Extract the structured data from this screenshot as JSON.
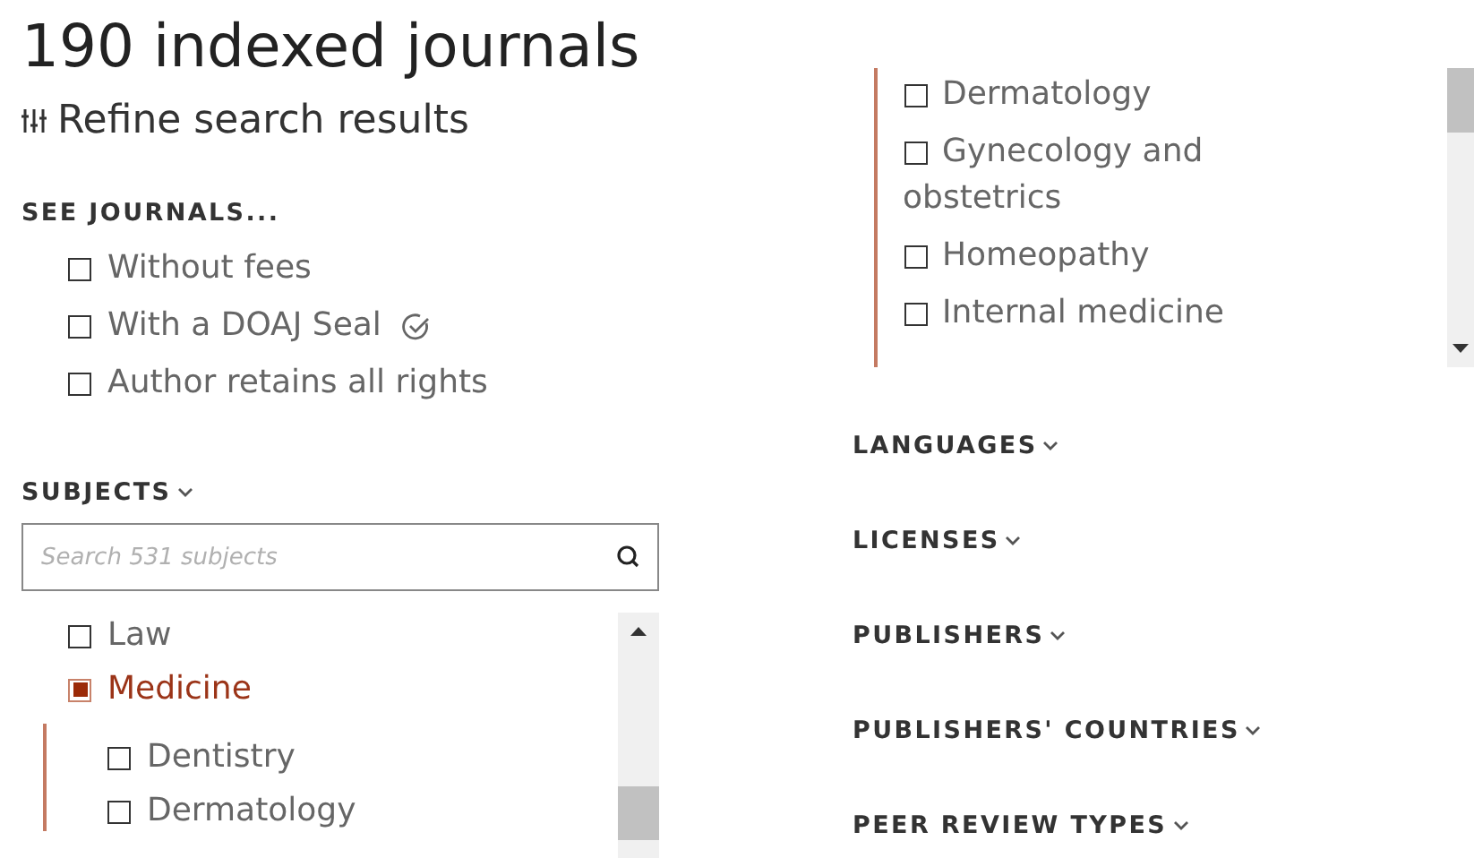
{
  "title": "190 indexed journals",
  "refine": {
    "label": "Refine search results"
  },
  "see_journals": {
    "heading": "SEE JOURNALS...",
    "options": [
      {
        "label": "Without fees",
        "checked": false,
        "seal": false
      },
      {
        "label": "With a DOAJ Seal",
        "checked": false,
        "seal": true
      },
      {
        "label": "Author retains all rights",
        "checked": false,
        "seal": false
      }
    ]
  },
  "subjects": {
    "heading": "SUBJECTS",
    "search": {
      "placeholder": "Search 531 subjects"
    },
    "items": [
      {
        "label": "Law",
        "checked": false
      },
      {
        "label": "Medicine",
        "checked": true,
        "children": [
          {
            "label": "Dentistry",
            "checked": false
          },
          {
            "label": "Dermatology",
            "checked": false
          }
        ]
      }
    ]
  },
  "subjects_continued": {
    "items": [
      {
        "label": "Dermatology",
        "checked": false
      },
      {
        "label": "Gynecology and obstetrics",
        "checked": false
      },
      {
        "label": "Homeopathy",
        "checked": false
      },
      {
        "label": "Internal medicine",
        "checked": false
      }
    ]
  },
  "sections": [
    {
      "heading": "LANGUAGES"
    },
    {
      "heading": "LICENSES"
    },
    {
      "heading": "PUBLISHERS"
    },
    {
      "heading": "PUBLISHERS' COUNTRIES"
    },
    {
      "heading": "PEER REVIEW TYPES"
    }
  ]
}
